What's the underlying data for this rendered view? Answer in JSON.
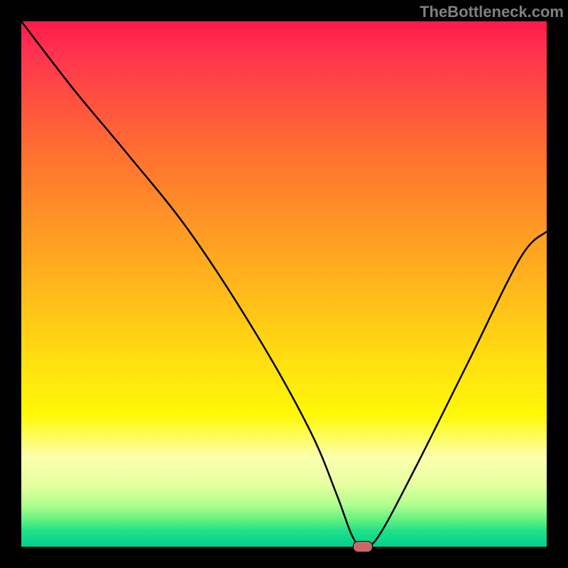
{
  "watermark": "TheBottleneck.com",
  "chart_data": {
    "type": "line",
    "title": "",
    "xlabel": "",
    "ylabel": "",
    "xlim": [
      0,
      100
    ],
    "ylim": [
      0,
      100
    ],
    "x": [
      0,
      10,
      20,
      32,
      45,
      55,
      60,
      63,
      65,
      68,
      75,
      85,
      95,
      100
    ],
    "values": [
      100,
      87,
      75,
      60,
      40,
      22,
      10,
      2,
      0,
      2,
      15,
      35,
      55,
      60
    ],
    "marker": {
      "x": 65,
      "y": 0
    },
    "background_gradient": {
      "top": "#ff1a4a",
      "mid": "#ffe010",
      "bottom": "#00d090"
    }
  }
}
